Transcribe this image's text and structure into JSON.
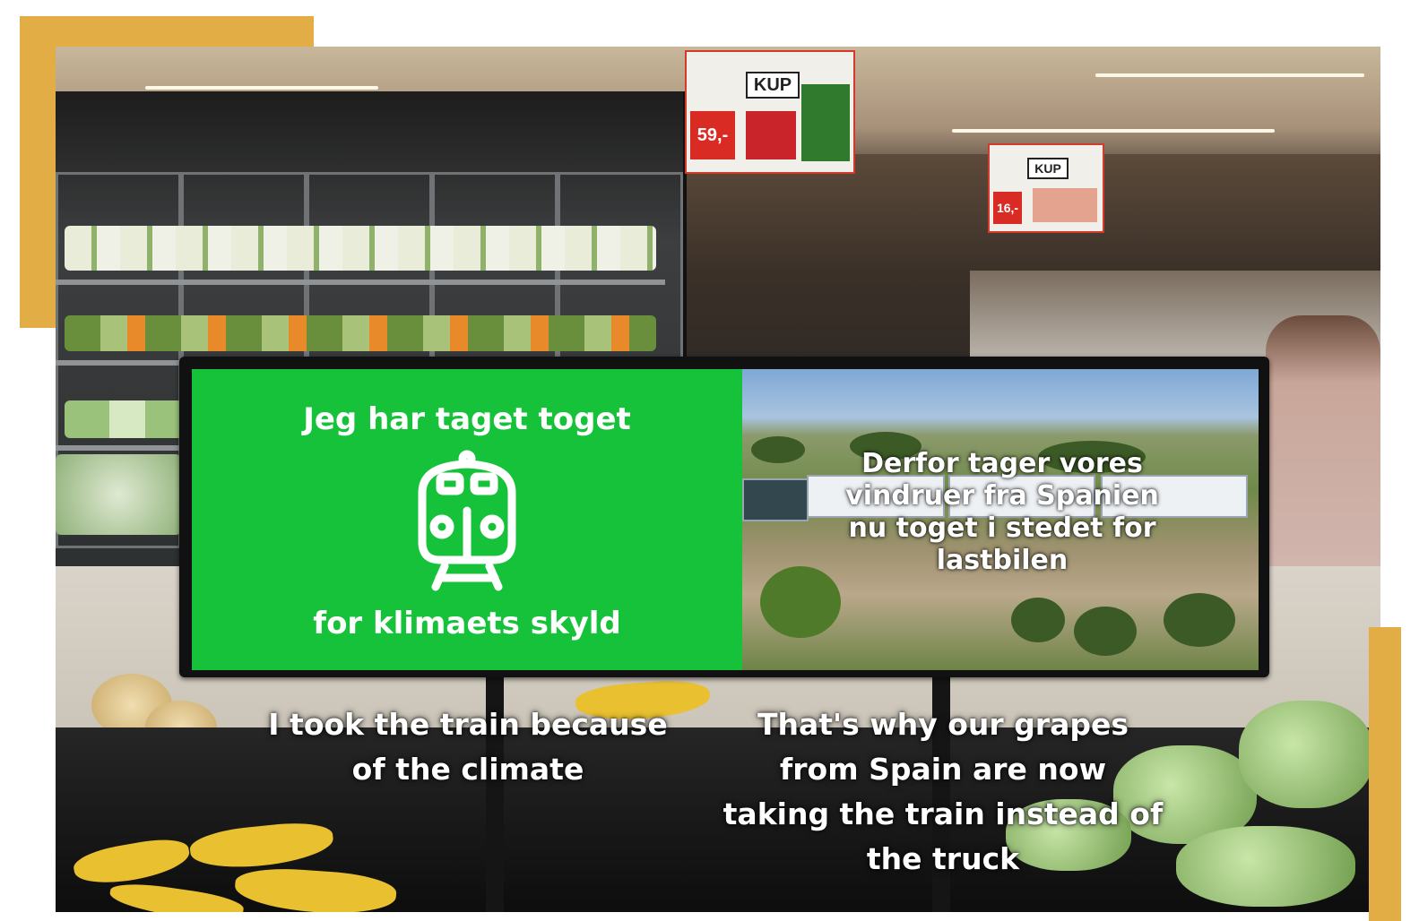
{
  "screen": {
    "left_panel": {
      "heading": "Jeg har taget toget",
      "subheading": "for klimaets skyld",
      "icon": "train-front-icon",
      "background_color": "#16c23a"
    },
    "right_panel": {
      "overlay_lines": [
        "Derfor tager vores",
        "vindruer fra Spanien",
        "nu toget i stedet for",
        "lastbilen"
      ]
    }
  },
  "captions": {
    "left_lines": [
      "I took the train because",
      "of the climate"
    ],
    "right_lines": [
      "That's why our grapes",
      "from Spain are now",
      "taking the train instead of",
      "the truck"
    ]
  },
  "store_signs": {
    "kup_label": "KUP",
    "top_price": "59,-",
    "second_price": "16,-"
  },
  "accent_color": "#e3ad45"
}
